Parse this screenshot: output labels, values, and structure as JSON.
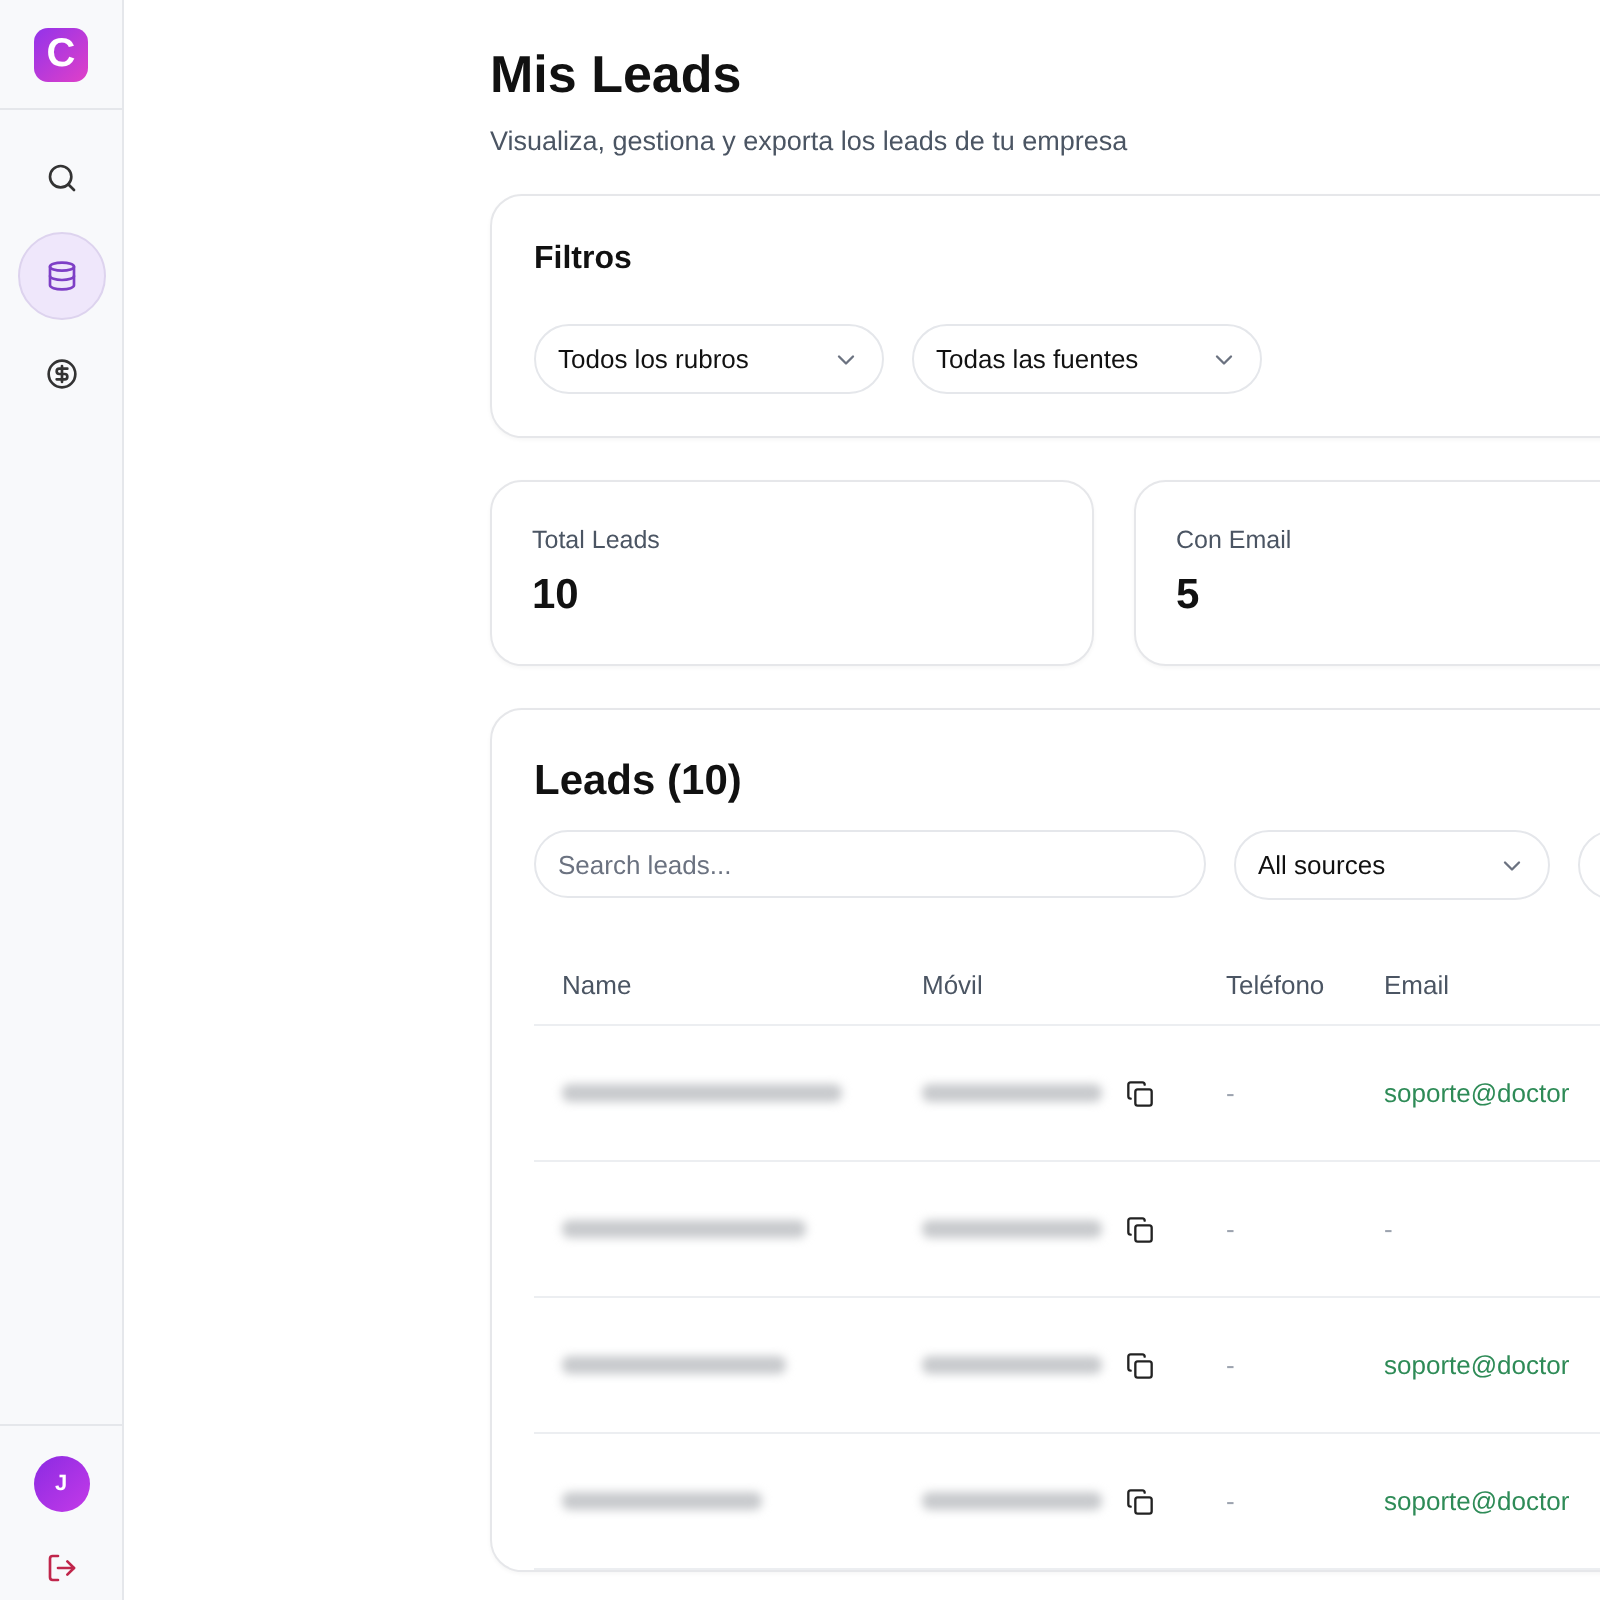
{
  "sidebar": {
    "logo": "C",
    "items": [
      {
        "kind": "search",
        "selected": false
      },
      {
        "kind": "database",
        "selected": true
      },
      {
        "kind": "dollar",
        "selected": false
      }
    ],
    "avatar": "J"
  },
  "header": {
    "title": "Mis Leads",
    "subtitle": "Visualiza, gestiona y exporta los leads de tu empresa"
  },
  "filters": {
    "title": "Filtros",
    "selects": [
      "Todos los rubros",
      "Todas las fuentes"
    ]
  },
  "stats": [
    {
      "label": "Total Leads",
      "value": "10"
    },
    {
      "label": "Con Email",
      "value": "5"
    }
  ],
  "leads": {
    "title": "Leads (10)",
    "search": {
      "placeholder": "Search leads..."
    },
    "source_select": "All sources",
    "columns": [
      "Name",
      "Móvil",
      "Teléfono",
      "Email"
    ],
    "rows": [
      {
        "telefono": "-",
        "email": "soporte@doctor"
      },
      {
        "telefono": "-",
        "email": "-"
      },
      {
        "telefono": "-",
        "email": "soporte@doctor"
      },
      {
        "telefono": "-",
        "email": "soporte@doctor"
      }
    ]
  }
}
